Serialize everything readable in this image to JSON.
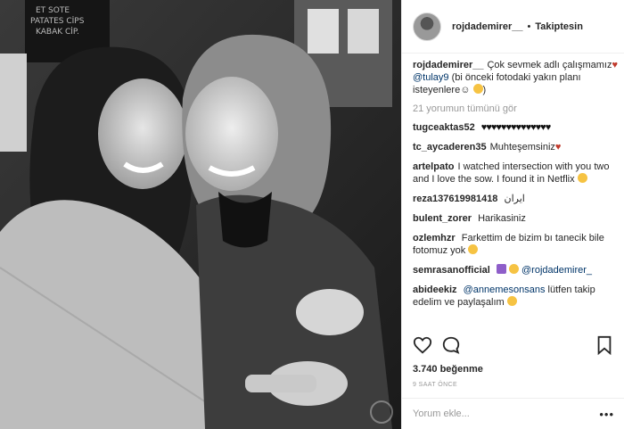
{
  "header": {
    "username": "rojdademirer__",
    "separator": "•",
    "follow_status": "Takiptesin"
  },
  "caption": {
    "username": "rojdademirer__",
    "text_1": "Çok sevmek adlı çalışmamız",
    "mention": "@tulay9",
    "text_2": "(bi önceki fotodaki yakın planı isteyenlere☺"
  },
  "view_all_comments": "21 yorumun tümünü gör",
  "comments": [
    {
      "user": "tugceaktas52",
      "text": "♥♥♥♥♥♥♥♥♥♥♥♥♥♥"
    },
    {
      "user": "tc_aycaderen35",
      "text": "Muhteşemsiniz"
    },
    {
      "user": "artelpato",
      "text": "I watched intersection with you two and I love the sow. I found it in Netflix"
    },
    {
      "user": "reza137619981418",
      "text": "ایران"
    },
    {
      "user": "bulent_zorer",
      "text": "Harikasiniz"
    },
    {
      "user": "ozlemhzr",
      "text": "Farkettim de bizim bı tanecik bile fotomuz yok"
    },
    {
      "user": "semrasanofficial",
      "mention": "@rojdademirer_"
    },
    {
      "user": "abideekiz",
      "mention": "@annemesonsans",
      "text": "lütfen takip edelim ve paylaşalım"
    }
  ],
  "actions": {
    "like_icon": "heart-outline-icon",
    "comment_icon": "speech-bubble-icon",
    "save_icon": "bookmark-icon"
  },
  "likes": "3.740 beğenme",
  "timestamp": "9 SAAT ÖNCE",
  "add_comment_placeholder": "Yorum ekle...",
  "more_options": "•••"
}
